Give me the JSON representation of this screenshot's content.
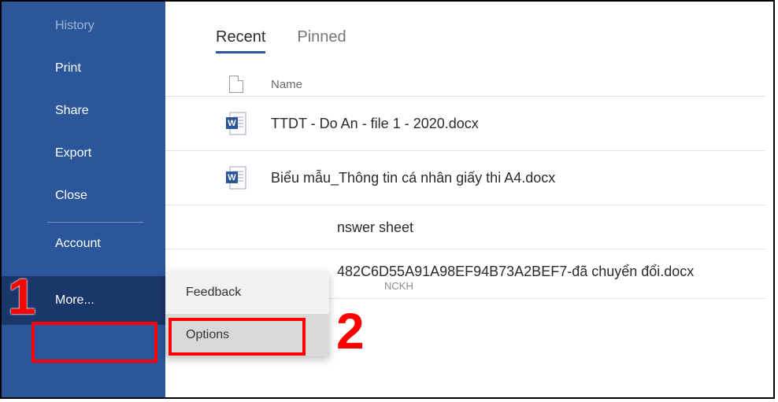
{
  "sidebar": {
    "items": [
      {
        "label": "History"
      },
      {
        "label": "Print"
      },
      {
        "label": "Share"
      },
      {
        "label": "Export"
      },
      {
        "label": "Close"
      },
      {
        "label": "Account"
      },
      {
        "label": "More..."
      }
    ]
  },
  "flyout": {
    "feedback": "Feedback",
    "options": "Options"
  },
  "tabs": {
    "recent": "Recent",
    "pinned": "Pinned"
  },
  "list": {
    "name_header": "Name",
    "rows": [
      {
        "name": "TTDT - Do An - file 1 - 2020.docx"
      },
      {
        "name": "Biểu mẫu_Thông tin cá nhân giấy thi A4.docx"
      }
    ],
    "partial_row": {
      "fragment": "nswer sheet"
    },
    "last_row": {
      "name": "482C6D55A91A98EF94B73A2BEF7-đã chuyển đổi.docx",
      "sub_fragment": "NCKH"
    }
  },
  "annotations": {
    "one": "1",
    "two": "2"
  }
}
